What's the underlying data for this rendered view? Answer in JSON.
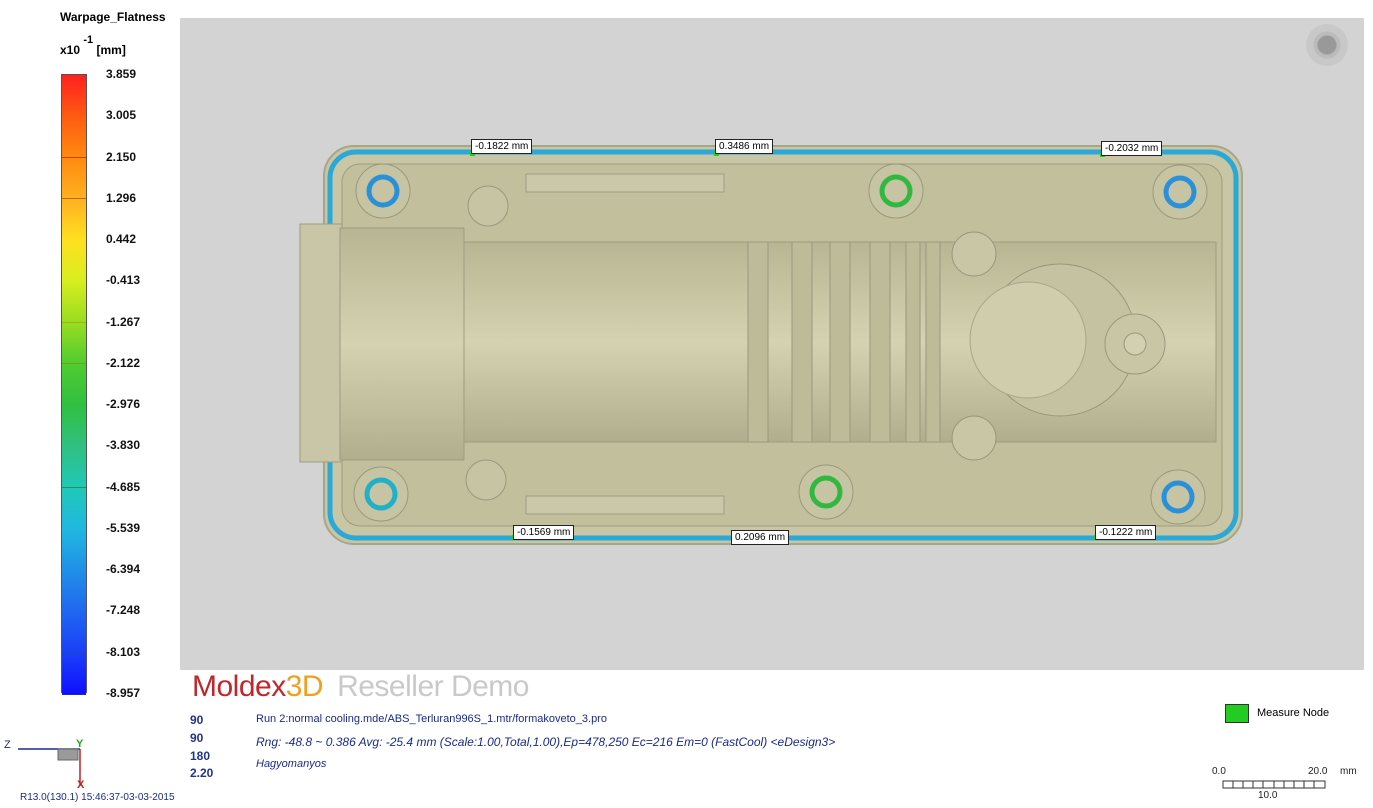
{
  "legend": {
    "title": "Warpage_Flatness",
    "unit_prefix": "x10",
    "unit_exponent": "-1",
    "unit_suffix": "[mm]",
    "ticks": [
      "3.859",
      "3.005",
      "2.150",
      "1.296",
      "0.442",
      "-0.413",
      "-1.267",
      "-2.122",
      "-2.976",
      "-3.830",
      "-4.685",
      "-5.539",
      "-6.394",
      "-7.248",
      "-8.103",
      "-8.957"
    ],
    "colors": [
      "#ff2020",
      "#ff5a10",
      "#ff8a10",
      "#ffb020",
      "#ffe020",
      "#d8ee20",
      "#98dd20",
      "#50cc30",
      "#30c040",
      "#30c080",
      "#20c8b8",
      "#20b8e0",
      "#2090e8",
      "#2068f0",
      "#1a40f8",
      "#1010ff"
    ]
  },
  "viewport": {
    "background": "#d3d3d3",
    "part_color": "#c8c6a4",
    "measurements": [
      "-0.1822 mm",
      "0.3486 mm",
      "-0.2032 mm",
      "-0.1569 mm",
      "0.2096 mm",
      "-0.1222 mm"
    ]
  },
  "brand": {
    "moldex": "Moldex",
    "three_d": "3D",
    "reseller": "Reseller Demo"
  },
  "view_numbers": [
    "90",
    "90",
    "180",
    "2.20"
  ],
  "info": {
    "run": "Run 2:normal cooling.mde/ABS_Terluran996S_1.mtr/formakoveto_3.pro",
    "range": "Rng: -48.8 ~ 0.386   Avg: -25.4 mm (Scale:1.00,Total,1.00),Ep=478,250 Ec=216 Em=0 (FastCool) <eDesign3>",
    "author": "Hagyomanyos"
  },
  "measure_node": {
    "label": "Measure Node",
    "color": "#22cc22"
  },
  "scale": {
    "start": "0.0",
    "end": "20.0",
    "unit": "mm",
    "mid": "10.0"
  },
  "axes": {
    "z": "Z",
    "y": "Y",
    "x": "X"
  },
  "footer": "R13.0(130.1) 15:46:37-03-03-2015"
}
